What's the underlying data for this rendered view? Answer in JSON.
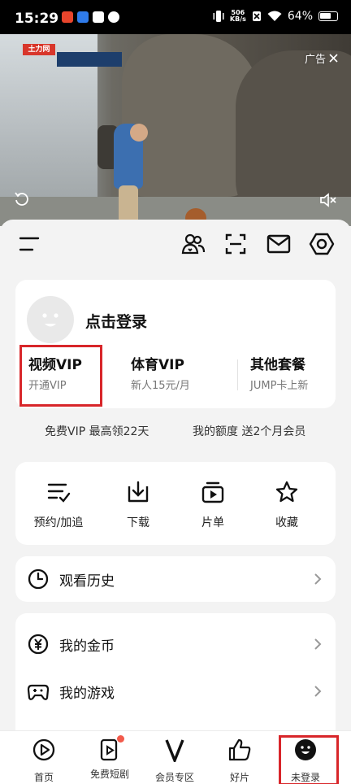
{
  "status_bar": {
    "time": "15:29",
    "net_speed_value": "506",
    "net_speed_unit": "KB/s",
    "battery": "64%"
  },
  "hero_ad": {
    "ad_label": "广告",
    "close_icon": "close-icon",
    "logo_text": "土力网"
  },
  "toolbar": {
    "icons": [
      "menu-icon",
      "friends-icon",
      "scan-icon",
      "mail-icon",
      "settings-icon"
    ]
  },
  "user_card": {
    "login_text": "点击登录",
    "vip_items": [
      {
        "title": "视频VIP",
        "subtitle": "开通VIP"
      },
      {
        "title": "体育VIP",
        "subtitle": "新人15元/月"
      },
      {
        "title": "其他套餐",
        "subtitle": "JUMP卡上新"
      }
    ]
  },
  "promo": {
    "left": "免费VIP 最高领22天",
    "right": "我的额度 送2个月会员"
  },
  "shortcuts": [
    {
      "label": "预约/加追",
      "icon": "list-check-icon"
    },
    {
      "label": "下载",
      "icon": "download-icon"
    },
    {
      "label": "片单",
      "icon": "playlist-icon"
    },
    {
      "label": "收藏",
      "icon": "star-icon"
    }
  ],
  "history": {
    "label": "观看历史",
    "icon": "clock-icon"
  },
  "list_items": [
    {
      "label": "我的金币",
      "icon": "coin-icon"
    },
    {
      "label": "我的游戏",
      "icon": "gamepad-icon"
    }
  ],
  "bottom_nav": [
    {
      "label": "首页",
      "icon": "home-play-icon"
    },
    {
      "label": "免费短剧",
      "icon": "short-drama-icon"
    },
    {
      "label": "会员专区",
      "icon": "vip-v-icon"
    },
    {
      "label": "好片",
      "icon": "thumbs-up-icon"
    },
    {
      "label": "未登录",
      "icon": "avatar-face-icon"
    }
  ],
  "colors": {
    "highlight_red": "#d8262a",
    "notification_dot": "#f25a4b",
    "background": "#f3f3f3"
  }
}
